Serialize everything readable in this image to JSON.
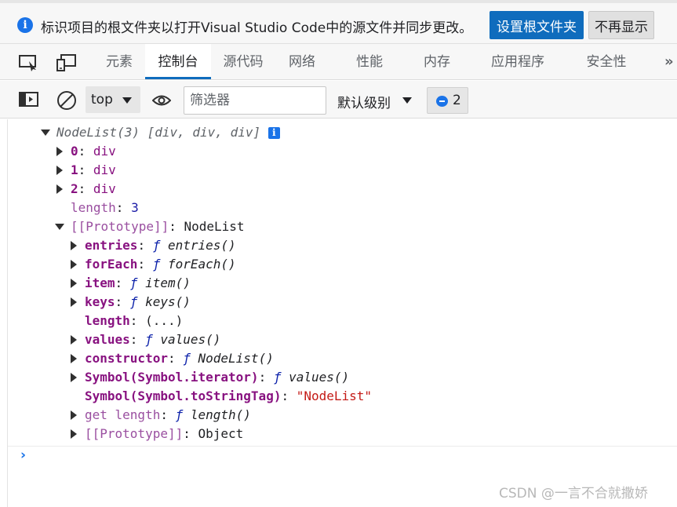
{
  "notification": {
    "message": "标识项目的根文件夹以打开Visual Studio Code中的源文件并同步更改。",
    "primary_button": "设置根文件夹",
    "secondary_button": "不再显示"
  },
  "tabs": [
    {
      "label": "元素"
    },
    {
      "label": "控制台",
      "active": true
    },
    {
      "label": "源代码"
    },
    {
      "label": "网络"
    },
    {
      "label": "性能"
    },
    {
      "label": "内存"
    },
    {
      "label": "应用程序"
    },
    {
      "label": "安全性"
    }
  ],
  "toolbar": {
    "context": "top",
    "filter_placeholder": "筛选器",
    "levels": "默认级别",
    "issues_count": "2"
  },
  "console": {
    "summary": {
      "name": "NodeList(3)",
      "preview": "[div, div, div]"
    },
    "items": [
      {
        "key": "0",
        "value": "div"
      },
      {
        "key": "1",
        "value": "div"
      },
      {
        "key": "2",
        "value": "div"
      }
    ],
    "length": {
      "key": "length",
      "value": "3"
    },
    "prototype": {
      "key": "[[Prototype]]",
      "value": "NodeList"
    },
    "proto_members": [
      {
        "key": "entries",
        "fn": "entries()"
      },
      {
        "key": "forEach",
        "fn": "forEach()"
      },
      {
        "key": "item",
        "fn": "item()"
      },
      {
        "key": "keys",
        "fn": "keys()"
      },
      {
        "key": "length",
        "getter": "(...)"
      },
      {
        "key": "values",
        "fn": "values()"
      },
      {
        "key": "constructor",
        "fn": "NodeList()"
      },
      {
        "key": "Symbol(Symbol.iterator)",
        "fn": "values()"
      },
      {
        "key": "Symbol(Symbol.toStringTag)",
        "str": "\"NodeList\""
      },
      {
        "key": "get length",
        "fn": "length()"
      },
      {
        "key": "[[Prototype]]",
        "value": "Object"
      }
    ],
    "prompt": "›"
  },
  "watermark": "CSDN @一言不合就撒娇"
}
